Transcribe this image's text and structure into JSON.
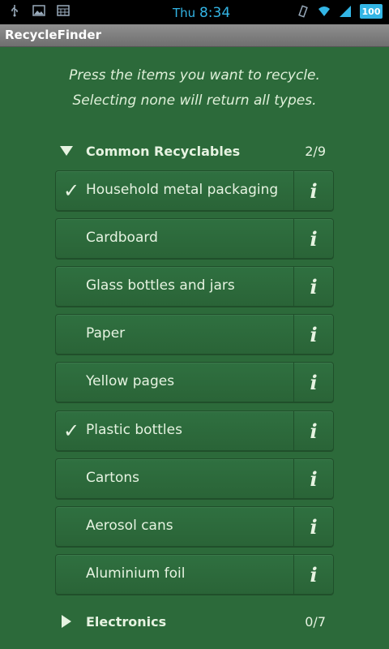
{
  "status_bar": {
    "day": "Thu",
    "time": "8:34",
    "battery": "100"
  },
  "app": {
    "title": "RecycleFinder"
  },
  "intro": {
    "line1": "Press the items you want to recycle.",
    "line2": "Selecting none will return all types."
  },
  "sections": [
    {
      "name": "Common Recyclables",
      "count": "2/9",
      "expanded": true,
      "items": [
        {
          "label": "Household metal packaging",
          "checked": true
        },
        {
          "label": "Cardboard",
          "checked": false
        },
        {
          "label": "Glass bottles and jars",
          "checked": false
        },
        {
          "label": "Paper",
          "checked": false
        },
        {
          "label": "Yellow pages",
          "checked": false
        },
        {
          "label": "Plastic bottles",
          "checked": true
        },
        {
          "label": "Cartons",
          "checked": false
        },
        {
          "label": "Aerosol cans",
          "checked": false
        },
        {
          "label": "Aluminium foil",
          "checked": false
        }
      ]
    },
    {
      "name": "Electronics",
      "count": "0/7",
      "expanded": false
    }
  ],
  "info_glyph": "i",
  "check_glyph": "✓",
  "colors": {
    "background": "#2c6a3a",
    "text": "#e6f3e1",
    "status_accent": "#33b5e5"
  }
}
